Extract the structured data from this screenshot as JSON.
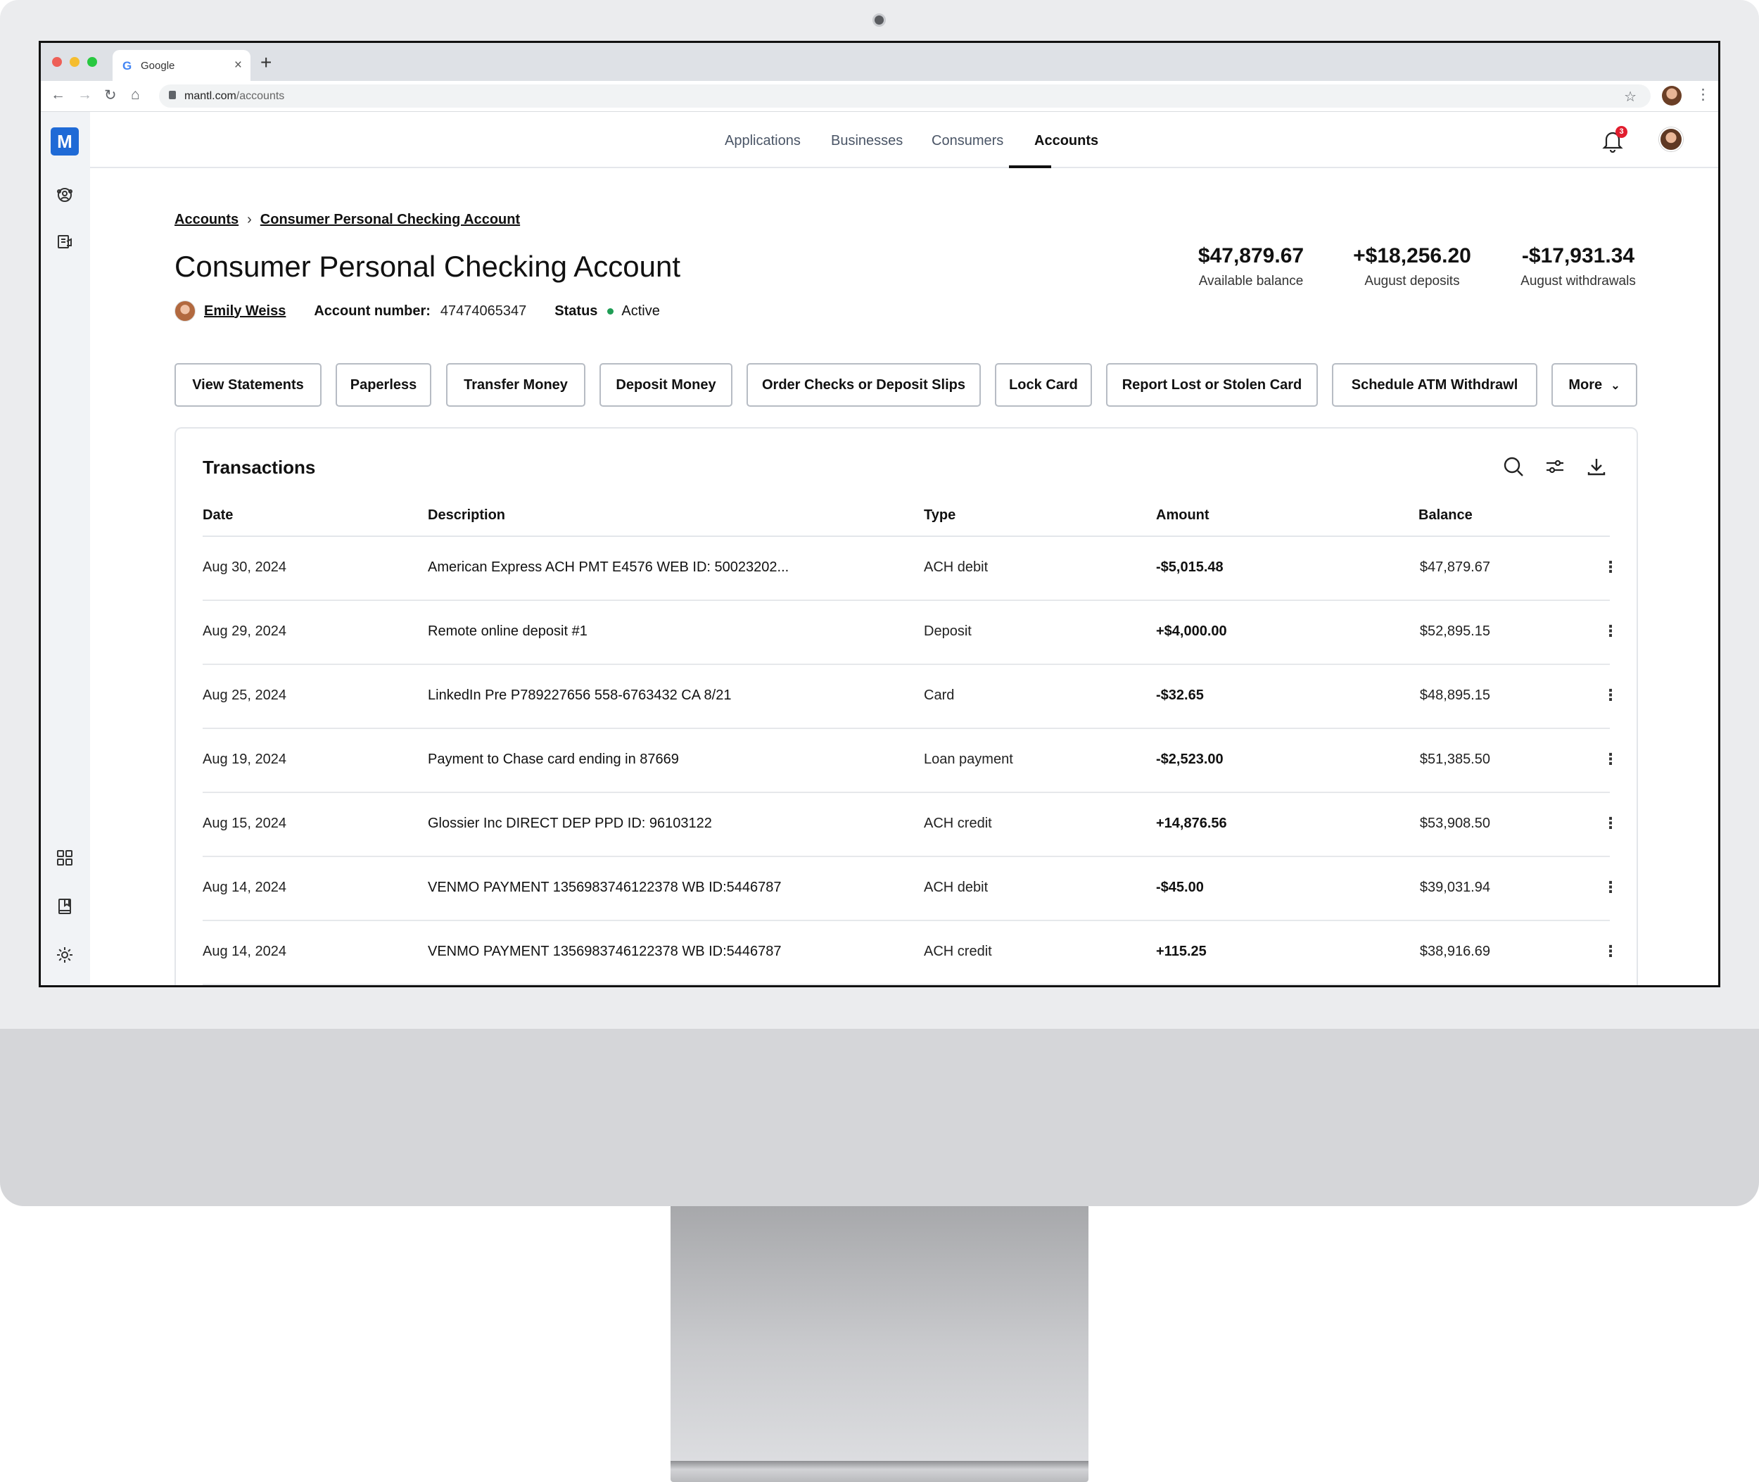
{
  "browser": {
    "tab_title": "Google",
    "tab_icon": "G",
    "close_glyph": "×",
    "new_tab_glyph": "+",
    "url_host": "mantl.com",
    "url_path": "/accounts"
  },
  "app": {
    "logo": "M",
    "nav": [
      "Applications",
      "Businesses",
      "Consumers",
      "Accounts"
    ],
    "active_nav": "Accounts",
    "notification_count": "3"
  },
  "breadcrumb": {
    "root": "Accounts",
    "separator": "›",
    "current": "Consumer Personal Checking Account"
  },
  "account": {
    "title": "Consumer Personal Checking Account",
    "owner": "Emily Weiss",
    "account_number_label": "Account number:",
    "account_number": "47474065347",
    "status_label": "Status",
    "status": "Active",
    "status_color": "#1f9d55"
  },
  "stats": [
    {
      "value": "$47,879.67",
      "label": "Available balance"
    },
    {
      "value": "+$18,256.20",
      "label": "August deposits"
    },
    {
      "value": "-$17,931.34",
      "label": "August withdrawals"
    }
  ],
  "actions": [
    "View Statements",
    "Paperless",
    "Transfer Money",
    "Deposit Money",
    "Order Checks or Deposit Slips",
    "Lock Card",
    "Report Lost or Stolen Card",
    "Schedule ATM Withdrawl",
    "More"
  ],
  "transactions": {
    "title": "Transactions",
    "columns": [
      "Date",
      "Description",
      "Type",
      "Amount",
      "Balance"
    ],
    "rows": [
      {
        "date": "Aug 30, 2024",
        "description": "American Express ACH PMT E4576 WEB ID: 50023202...",
        "type": "ACH debit",
        "amount": "-$5,015.48",
        "balance": "$47,879.67"
      },
      {
        "date": "Aug 29, 2024",
        "description": "Remote online deposit #1",
        "type": "Deposit",
        "amount": "+$4,000.00",
        "balance": "$52,895.15"
      },
      {
        "date": "Aug 25, 2024",
        "description": "LinkedIn Pre P789227656 558-6763432 CA 8/21",
        "type": "Card",
        "amount": "-$32.65",
        "balance": "$48,895.15"
      },
      {
        "date": "Aug 19, 2024",
        "description": "Payment to Chase card ending in 87669",
        "type": "Loan payment",
        "amount": "-$2,523.00",
        "balance": "$51,385.50"
      },
      {
        "date": "Aug 15, 2024",
        "description": "Glossier Inc DIRECT DEP PPD ID: 96103122",
        "type": "ACH credit",
        "amount": "+14,876.56",
        "balance": "$53,908.50"
      },
      {
        "date": "Aug 14, 2024",
        "description": "VENMO PAYMENT 1356983746122378 WB ID:5446787",
        "type": "ACH debit",
        "amount": "-$45.00",
        "balance": "$39,031.94"
      },
      {
        "date": "Aug 14, 2024",
        "description": "VENMO PAYMENT 1356983746122378 WB ID:5446787",
        "type": "ACH credit",
        "amount": "+115.25",
        "balance": "$38,916.69"
      }
    ],
    "row_menu_glyph": "⋮"
  },
  "icons": {
    "sidebar_top": [
      "team-icon",
      "bank-icon"
    ],
    "sidebar_bottom": [
      "grid-icon",
      "book-icon",
      "gear-icon"
    ],
    "toolbar": [
      "search-icon",
      "filter-icon",
      "download-icon"
    ]
  },
  "colors": {
    "brand": "#1f6ad6",
    "badge": "#e11d2e"
  }
}
